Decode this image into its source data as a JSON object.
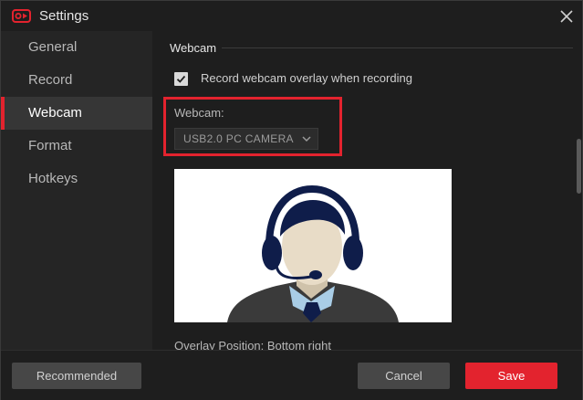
{
  "window": {
    "title": "Settings",
    "accent_color": "#e3232e",
    "app_icon": "video-camera-logo-icon",
    "close_icon": "close-icon"
  },
  "sidebar": {
    "items": [
      {
        "label": "General",
        "active": false
      },
      {
        "label": "Record",
        "active": false
      },
      {
        "label": "Webcam",
        "active": true
      },
      {
        "label": "Format",
        "active": false
      },
      {
        "label": "Hotkeys",
        "active": false
      }
    ]
  },
  "content": {
    "section_title": "Webcam",
    "record_overlay": {
      "label": "Record webcam overlay when recording",
      "checked": true
    },
    "webcam": {
      "label": "Webcam:",
      "selected": "USB2.0 PC CAMERA"
    },
    "preview_icon": "person-with-headset-illustration",
    "overlay_position": "Overlay Position: Bottom right"
  },
  "footer": {
    "recommended_label": "Recommended",
    "cancel_label": "Cancel",
    "save_label": "Save"
  }
}
